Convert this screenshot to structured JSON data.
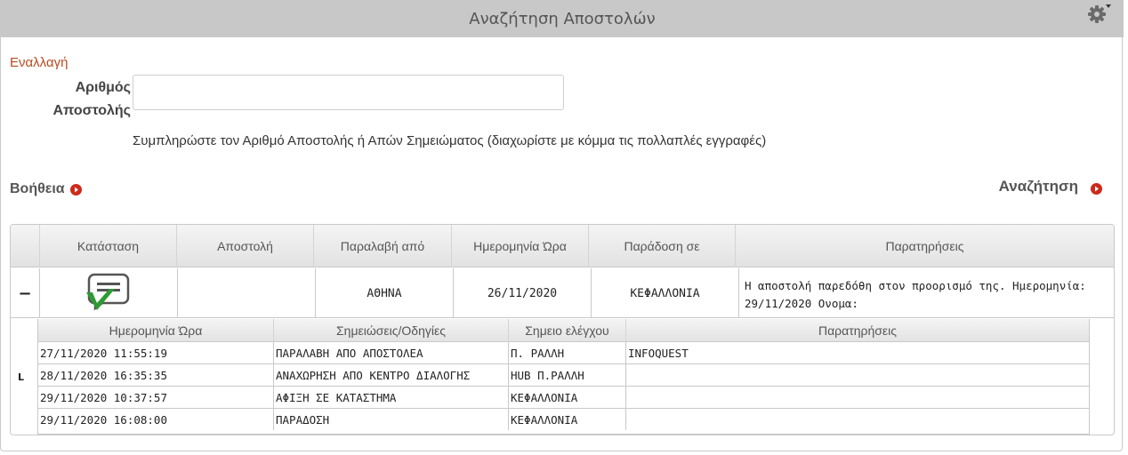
{
  "header": {
    "title": "Αναζήτηση Αποστολών",
    "settings_icon": "gear-icon"
  },
  "form": {
    "switch_label": "Εναλλαγή",
    "field_label": "Αριθμός Αποστολής",
    "field_value": "",
    "hint": "Συμπληρώστε τον Αριθμό Αποστολής ή Απών Σημειώματος (διαχωρίστε με κόμμα τις πολλαπλές εγγραφές)"
  },
  "actions": {
    "help_label": "Βοήθεια",
    "search_label": "Αναζήτηση"
  },
  "results": {
    "columns": [
      "Κατάσταση",
      "Αποστολή",
      "Παραλαβή από",
      "Ημερομηνία Ώρα",
      "Παράδοση σε",
      "Παρατηρήσεις"
    ],
    "row": {
      "collapse_symbol": "−",
      "status_icon": "delivered-check-icon",
      "shipment": "",
      "pickup_from": "ΑΘΗΝΑ",
      "datetime": "26/11/2020",
      "delivery_to": "ΚΕΦΑΛΛΟΝΙΑ",
      "remarks": "Η αποστολή παρεδόθη στον προορισμό της. Ημερομηνία: 29/11/2020 Ονομα:"
    },
    "detail": {
      "toggle_symbol": "L",
      "columns": [
        "Ημερομηνία Ώρα",
        "Σημειώσεις/Οδηγίες",
        "Σημειο ελέγχου",
        "Παρατηρήσεις"
      ],
      "rows": [
        [
          "27/11/2020 11:55:19",
          "ΠΑΡΑΛΑΒΗ ΑΠΟ ΑΠΟΣΤΟΛΕΑ",
          "Π. ΡΑΛΛΗ",
          "INFOQUEST"
        ],
        [
          "28/11/2020 16:35:35",
          "ΑΝΑΧΩΡΗΣΗ ΑΠΟ ΚΕΝΤΡΟ ΔΙΑΛΟΓΗΣ",
          "HUB Π.ΡΑΛΛΗ",
          ""
        ],
        [
          "29/11/2020 10:37:57",
          "ΑΦΙΞΗ ΣΕ ΚΑΤΑΣΤΗΜΑ",
          "ΚΕΦΑΛΛΟΝΙΑ",
          ""
        ],
        [
          "29/11/2020 16:08:00",
          "ΠΑΡΑΔΟΣΗ",
          "ΚΕΦΑΛΛΟΝΙΑ",
          ""
        ]
      ]
    }
  },
  "colors": {
    "title_bar": "#c8c8c8",
    "link": "#b84a1f",
    "arrow": "#cc2a1b",
    "check": "#2e9a35"
  }
}
